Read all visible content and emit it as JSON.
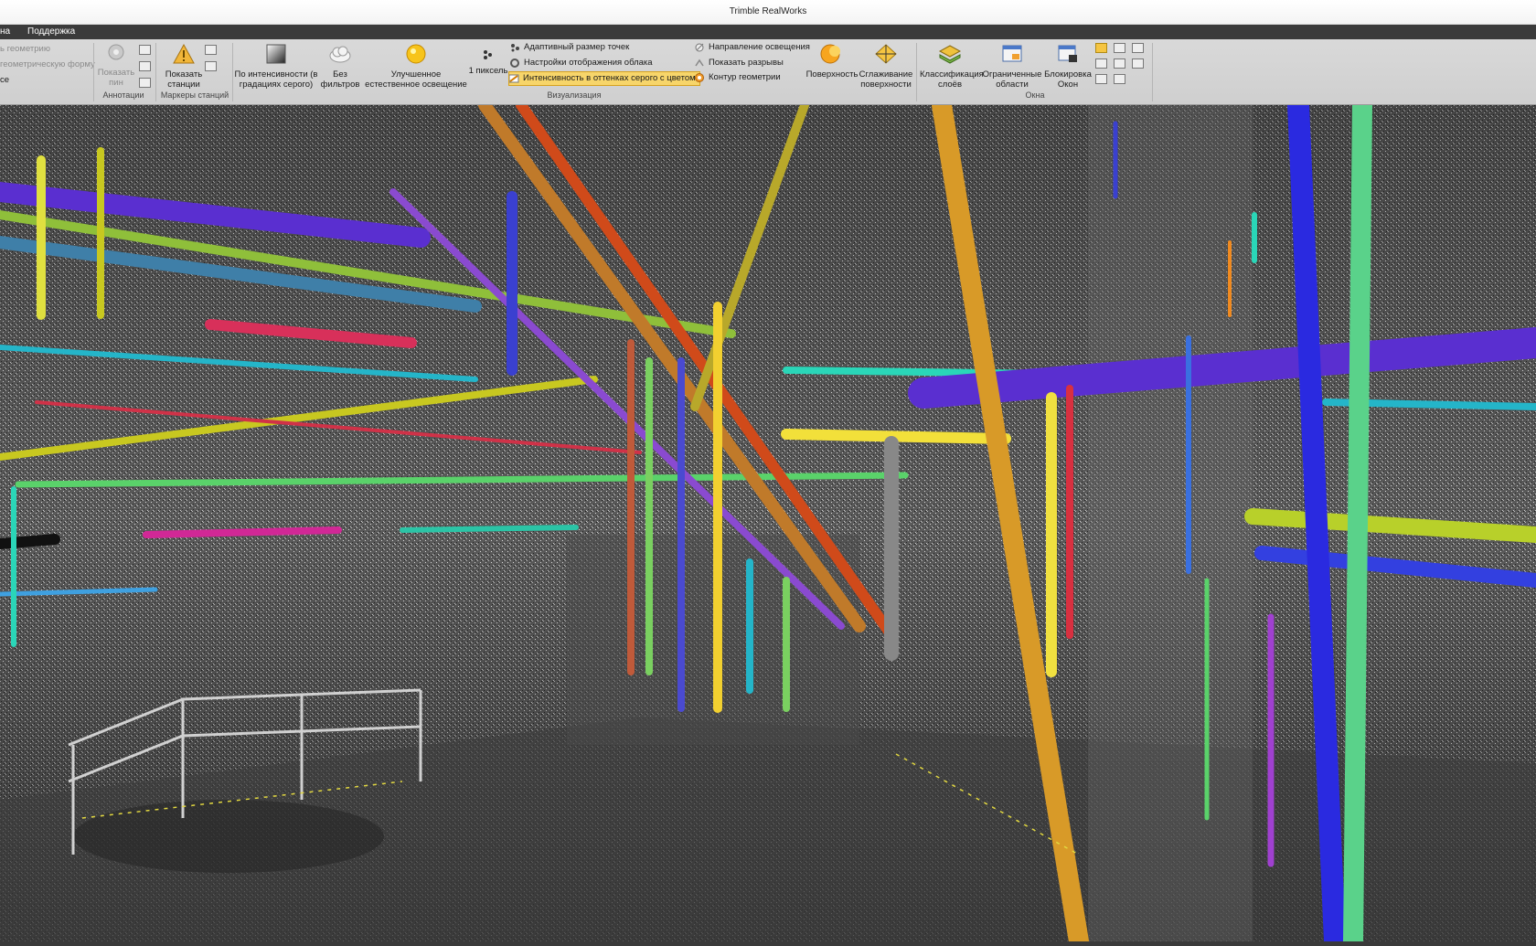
{
  "window": {
    "title": "Trimble RealWorks"
  },
  "menu": {
    "items": [
      "на",
      "Поддержка"
    ]
  },
  "ribbon": {
    "left_cut": [
      "ь геометрию",
      "геометрическую форму",
      "се"
    ],
    "annotations": {
      "show_pin": "Показать пин",
      "group": "Аннотации"
    },
    "stations": {
      "show_stations": "Показать станции",
      "group": "Маркеры станций"
    },
    "visualization": {
      "group": "Визуализация",
      "intensity": "По интенсивности (в градациях серого)",
      "filters": "Без фильтров",
      "lighting": "Улучшенное естественное освещение",
      "pixel": "1 пиксель",
      "adaptive": "Адаптивный размер точек",
      "cloud_settings": "Настройки отображения облака",
      "gray_color": "Интенсивность в оттенках серого с цветом",
      "light_dir": "Направление освещения",
      "show_gaps": "Показать разрывы",
      "contour": "Контур геометрии",
      "surface": "Поверхность",
      "smoothing": "Сглаживание поверхности"
    },
    "windows": {
      "group": "Окна",
      "layers": "Классификация слоёв",
      "limited": "Ограниченные области",
      "lock": "Блокировка Окон"
    }
  },
  "colors": {
    "accent": "#f5c542",
    "pipe_blue": "#2a2ae0",
    "pipe_orange": "#d98a1f"
  }
}
